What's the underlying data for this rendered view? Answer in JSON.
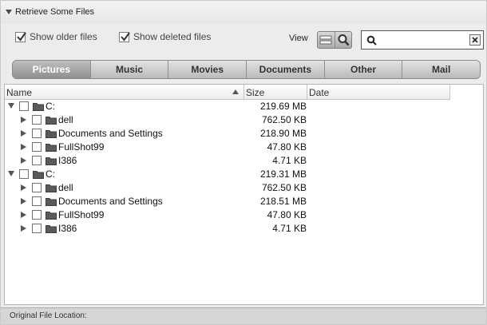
{
  "header": {
    "title": "Retrieve Some Files"
  },
  "options": {
    "show_older": {
      "label": "Show older files",
      "checked": true
    },
    "show_deleted": {
      "label": "Show deleted files",
      "checked": true
    },
    "view_label": "View",
    "search_value": ""
  },
  "tabs": [
    {
      "label": "Pictures",
      "active": true
    },
    {
      "label": "Music",
      "active": false
    },
    {
      "label": "Movies",
      "active": false
    },
    {
      "label": "Documents",
      "active": false
    },
    {
      "label": "Other",
      "active": false
    },
    {
      "label": "Mail",
      "active": false
    }
  ],
  "columns": {
    "name": "Name",
    "size": "Size",
    "date": "Date"
  },
  "rows": [
    {
      "name": "C:",
      "size": "219.69 MB",
      "level": 0,
      "expanded": true
    },
    {
      "name": "dell",
      "size": "762.50 KB",
      "level": 1,
      "expanded": false
    },
    {
      "name": "Documents and Settings",
      "size": "218.90 MB",
      "level": 1,
      "expanded": false
    },
    {
      "name": "FullShot99",
      "size": "47.80 KB",
      "level": 1,
      "expanded": false
    },
    {
      "name": "I386",
      "size": "4.71 KB",
      "level": 1,
      "expanded": false
    },
    {
      "name": "C:",
      "size": "219.31 MB",
      "level": 0,
      "expanded": true
    },
    {
      "name": "dell",
      "size": "762.50 KB",
      "level": 1,
      "expanded": false
    },
    {
      "name": "Documents and Settings",
      "size": "218.51 MB",
      "level": 1,
      "expanded": false
    },
    {
      "name": "FullShot99",
      "size": "47.80 KB",
      "level": 1,
      "expanded": false
    },
    {
      "name": "I386",
      "size": "4.71 KB",
      "level": 1,
      "expanded": false
    }
  ],
  "status": {
    "label": "Original File Location:"
  }
}
